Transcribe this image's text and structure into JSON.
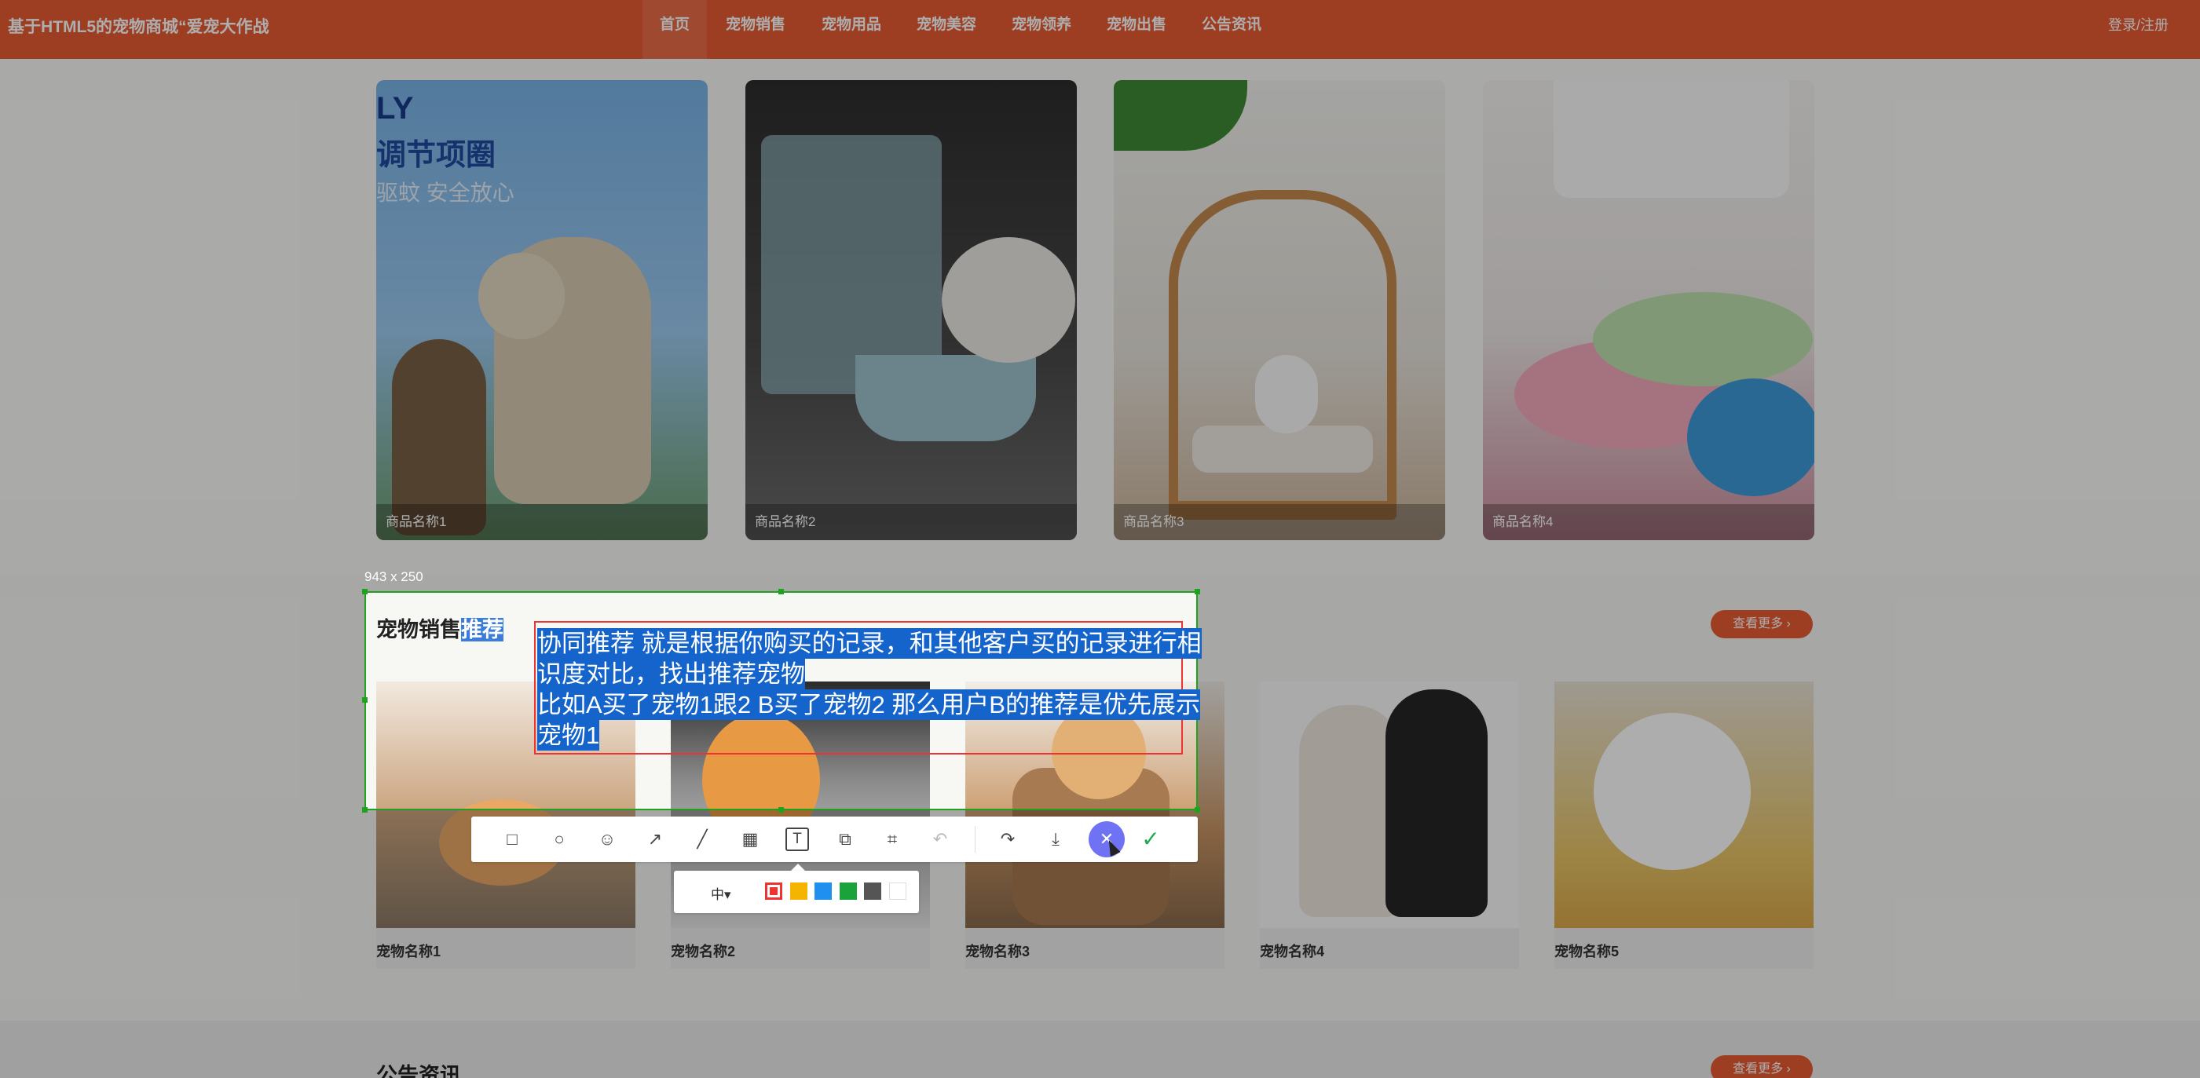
{
  "navbar": {
    "brand": "基于HTML5的宠物商城“爱宠大作战",
    "items": [
      {
        "label": "首页",
        "active": true
      },
      {
        "label": "宠物销售",
        "active": false
      },
      {
        "label": "宠物用品",
        "active": false
      },
      {
        "label": "宠物美容",
        "active": false
      },
      {
        "label": "宠物领养",
        "active": false
      },
      {
        "label": "宠物出售",
        "active": false
      },
      {
        "label": "公告资讯",
        "active": false
      }
    ],
    "login": "登录/注册",
    "color": "#e85c34"
  },
  "products": [
    {
      "name": "商品名称1",
      "banner_lines": [
        "LY",
        "调节项圈",
        "驱蚊 安全放心"
      ]
    },
    {
      "name": "商品名称2"
    },
    {
      "name": "商品名称3"
    },
    {
      "name": "商品名称4"
    }
  ],
  "pet_section": {
    "title_prefix": "宠物销售",
    "title_highlight": "推荐",
    "more": "查看更多 ›",
    "pets": [
      {
        "name": "宠物名称1"
      },
      {
        "name": "宠物名称2"
      },
      {
        "name": "宠物名称3"
      },
      {
        "name": "宠物名称4"
      },
      {
        "name": "宠物名称5"
      }
    ]
  },
  "notice_section": {
    "title": "公告资讯",
    "more": "查看更多 ›"
  },
  "screenshot_overlay": {
    "size_label": "943 x 250",
    "note_lines": [
      "协同推荐  就是根据你购买的记录，和其他客户买的记录进行相",
      "识度对比，找出推荐宠物",
      "比如A买了宠物1跟2  B买了宠物2  那么用户B的推荐是优先展示",
      "宠物1"
    ],
    "toolbar_tools": [
      {
        "icon": "rectangle-icon",
        "glyph": "□"
      },
      {
        "icon": "ellipse-icon",
        "glyph": "○"
      },
      {
        "icon": "emoji-icon",
        "glyph": "☺"
      },
      {
        "icon": "arrow-icon",
        "glyph": "↗"
      },
      {
        "icon": "pen-icon",
        "glyph": "╱"
      },
      {
        "icon": "mosaic-icon",
        "glyph": "▦"
      },
      {
        "icon": "text-icon",
        "glyph": "T"
      },
      {
        "icon": "pin-icon",
        "glyph": "⧉"
      },
      {
        "icon": "ocr-icon",
        "glyph": "⌗"
      },
      {
        "icon": "undo-icon",
        "glyph": "↶"
      },
      {
        "icon": "share-icon",
        "glyph": "↷"
      },
      {
        "icon": "download-icon",
        "glyph": "⤓"
      },
      {
        "icon": "cancel-icon",
        "glyph": "✕"
      },
      {
        "icon": "confirm-icon",
        "glyph": "✓"
      }
    ],
    "text_size": "中▾",
    "colors": [
      "#e33333",
      "#f5b400",
      "#1f8ff0",
      "#19a33a",
      "#555555",
      "#ffffff"
    ]
  }
}
